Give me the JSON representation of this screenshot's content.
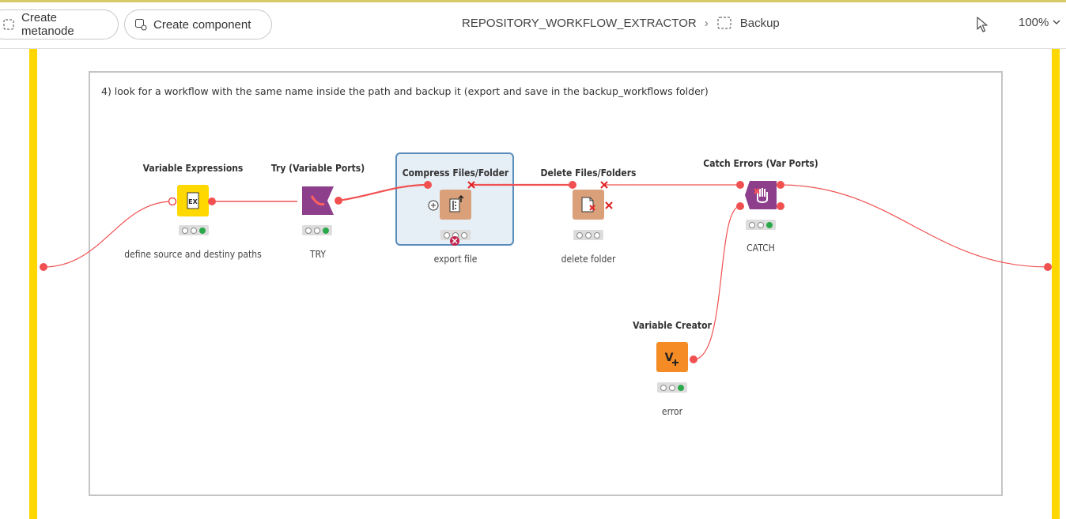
{
  "toolbar": {
    "create_metanode": "Create metanode",
    "create_component": "Create component",
    "breadcrumb_workflow": "REPOSITORY_WORKFLOW_EXTRACTOR",
    "breadcrumb_separator": "›",
    "breadcrumb_current": "Backup",
    "zoom": "100%"
  },
  "annotation": {
    "text": "4) look for a workflow with the same name inside the path and backup it (export and save in the backup_workflows folder)"
  },
  "nodes": [
    {
      "title": "Variable Expressions",
      "label": "define source and destiny paths",
      "color": "#ffd800",
      "icon": "ex-icon"
    },
    {
      "title": "Try (Variable Ports)",
      "label": "TRY",
      "color": "#8e3f8c",
      "icon": "try-icon"
    },
    {
      "title": "Compress Files/Folder",
      "label": "export file",
      "color": "#d9a07a",
      "icon": "compress-icon"
    },
    {
      "title": "Delete Files/Folders",
      "label": "delete folder",
      "color": "#d9a07a",
      "icon": "delete-file-icon"
    },
    {
      "title": "Catch Errors (Var Ports)",
      "label": "CATCH",
      "color": "#8e3f8c",
      "icon": "catch-icon"
    },
    {
      "title": "Variable Creator",
      "label": "error",
      "color": "#f58b24",
      "icon": "variable-creator-icon"
    }
  ],
  "colors": {
    "metanode_bar": "#ffd700",
    "wire": "#f05050",
    "selection": "#5a8dbb"
  }
}
